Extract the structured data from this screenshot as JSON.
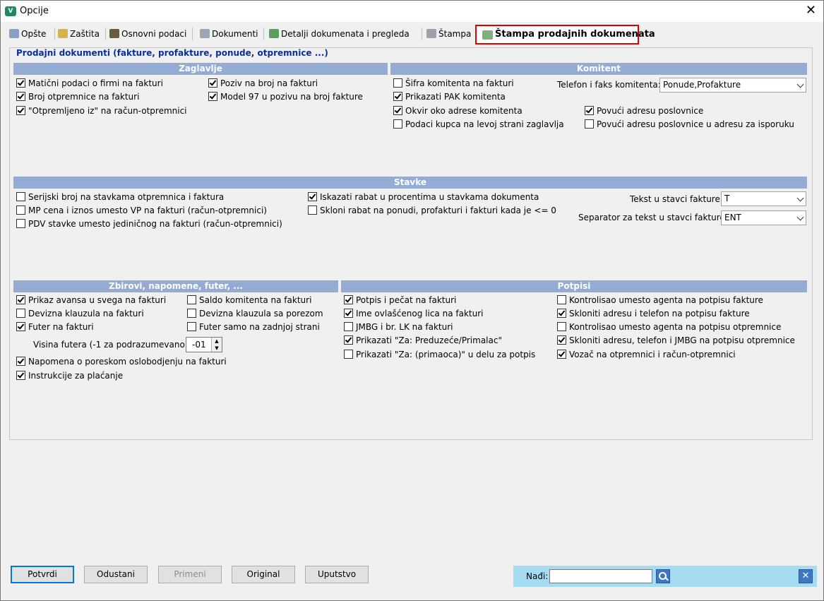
{
  "window": {
    "title": "Opcije",
    "close_label": "✕"
  },
  "tabs": [
    {
      "label": "Opšte",
      "icon": "gear-icon"
    },
    {
      "label": "Zaštita",
      "icon": "lock-icon"
    },
    {
      "label": "Osnovni podaci",
      "icon": "book-icon"
    },
    {
      "label": "Dokumenti",
      "icon": "document-icon"
    },
    {
      "label": "Detalji dokumenata i pregleda",
      "icon": "document-detail-icon"
    },
    {
      "label": "Štampa",
      "icon": "printer-icon"
    },
    {
      "label": "Štampa prodajnih dokumenata",
      "icon": "printer-green-icon",
      "active": true
    }
  ],
  "pane": {
    "title": "Prodajni dokumenti (fakture, profakture, ponude, otpremnice ...)"
  },
  "zaglavlje": {
    "header": "Zaglavlje",
    "items": [
      {
        "label": "Matični podaci o firmi na fakturi",
        "checked": true
      },
      {
        "label": "Broj otpremnice na fakturi",
        "checked": true
      },
      {
        "label": "\"Otpremljeno iz\" na račun-otpremnici",
        "checked": true
      },
      {
        "label": "Poziv na broj na fakturi",
        "checked": true
      },
      {
        "label": "Model 97 u pozivu na broj fakture",
        "checked": true
      }
    ]
  },
  "komitent": {
    "header": "Komitent",
    "items": [
      {
        "label": "Šifra komitenta na fakturi",
        "checked": false
      },
      {
        "label": "Prikazati PAK komitenta",
        "checked": true
      },
      {
        "label": "Okvir oko adrese komitenta",
        "checked": true
      },
      {
        "label": "Podaci kupca na levoj strani zaglavlja",
        "checked": false
      },
      {
        "label": "Povući adresu poslovnice",
        "checked": true
      },
      {
        "label": "Povući adresu poslovnice u adresu za isporuku",
        "checked": false
      }
    ],
    "phone_fax_label": "Telefon i faks komitenta:",
    "phone_fax_value": "Ponude,Profakture"
  },
  "stavke": {
    "header": "Stavke",
    "items": [
      {
        "label": "Serijski broj na stavkama otpremnica i faktura",
        "checked": false
      },
      {
        "label": "MP cena i iznos umesto VP na fakturi (račun-otpremnici)",
        "checked": false
      },
      {
        "label": "PDV stavke umesto jediničnog na fakturi (račun-otpremnici)",
        "checked": false
      },
      {
        "label": "Iskazati rabat u procentima u stavkama dokumenta",
        "checked": true
      },
      {
        "label": "Skloni rabat na ponudi, profakturi i fakturi kada je <= 0",
        "checked": false
      }
    ],
    "text_label": "Tekst u stavci fakture:",
    "text_value": "T",
    "separator_label": "Separator za tekst u stavci fakture:",
    "separator_value": "ENT"
  },
  "zbirovi": {
    "header": "Zbirovi, napomene, futer, ...",
    "items": [
      {
        "label": "Prikaz avansa u svega na fakturi",
        "checked": true
      },
      {
        "label": "Devizna klauzula na fakturi",
        "checked": false
      },
      {
        "label": "Futer na fakturi",
        "checked": true
      },
      {
        "label": "Saldo komitenta na fakturi",
        "checked": false
      },
      {
        "label": "Devizna klauzula sa porezom",
        "checked": false
      },
      {
        "label": "Futer samo na zadnjoj strani",
        "checked": false
      },
      {
        "label": "Napomena o poreskom oslobodjenju na fakturi",
        "checked": true
      },
      {
        "label": "Instrukcije za plaćanje",
        "checked": true
      }
    ],
    "footer_height_label": "Visina futera (-1 za podrazumevano):",
    "footer_height_value": "-01"
  },
  "potpisi": {
    "header": "Potpisi",
    "items": [
      {
        "label": "Potpis i pečat na fakturi",
        "checked": true
      },
      {
        "label": "Ime ovlašćenog lica na fakturi",
        "checked": true
      },
      {
        "label": "JMBG i br. LK na fakturi",
        "checked": false
      },
      {
        "label": "Prikazati \"Za: Preduzeće/Primalac\"",
        "checked": true
      },
      {
        "label": "Prikazati \"Za: (primaoca)\" u delu za potpis",
        "checked": false
      },
      {
        "label": "Kontrolisao umesto agenta na potpisu fakture",
        "checked": false
      },
      {
        "label": "Skloniti adresu i telefon na potpisu fakture",
        "checked": true
      },
      {
        "label": "Kontrolisao umesto agenta na potpisu otpremnice",
        "checked": false
      },
      {
        "label": "Skloniti adresu, telefon i JMBG na potpisu otpremnice",
        "checked": true
      },
      {
        "label": "Vozač na otpremnici i račun-otpremnici",
        "checked": true
      }
    ]
  },
  "buttons": {
    "confirm": "Potvrdi",
    "cancel": "Odustani",
    "apply": "Primeni",
    "original": "Original",
    "help": "Uputstvo"
  },
  "find": {
    "label": "Nađi:",
    "value": ""
  },
  "colors": {
    "section_header": "#94abd4",
    "pane_title": "#0a2f9c",
    "active_tab_border": "#e00000",
    "find_bar": "#a6dcf2"
  }
}
